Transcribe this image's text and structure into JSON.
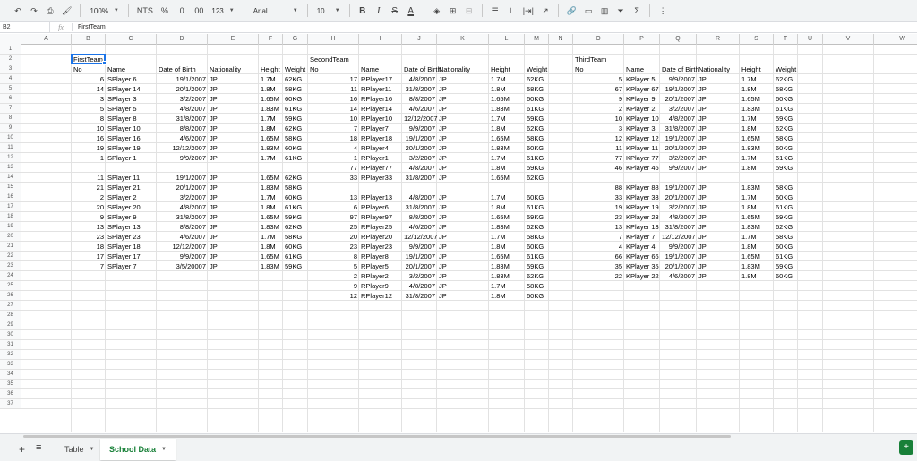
{
  "toolbar": {
    "zoom": "100%",
    "currency": "NTS",
    "percent": "%",
    "dec_decrease": ".0",
    "dec_increase": ".00",
    "number_format": "123",
    "font": "Arial",
    "font_size": "10",
    "bold": "B",
    "italic": "I",
    "strike": "S",
    "text_color": "A"
  },
  "formula_bar": {
    "cell_ref": "B2",
    "value": "FirstTeam"
  },
  "columns": [
    "A",
    "B",
    "C",
    "D",
    "E",
    "F",
    "G",
    "H",
    "I",
    "J",
    "K",
    "L",
    "M",
    "N",
    "O",
    "P",
    "Q",
    "R",
    "S",
    "T",
    "U",
    "V",
    "W"
  ],
  "rows": [
    "1",
    "2",
    "3",
    "4",
    "5",
    "6",
    "7",
    "8",
    "9",
    "10",
    "11",
    "12",
    "13",
    "14",
    "15",
    "16",
    "17",
    "18",
    "19",
    "20",
    "21",
    "22",
    "23",
    "24",
    "25",
    "26",
    "27",
    "28",
    "29",
    "30",
    "31",
    "32",
    "33",
    "34",
    "35",
    "36",
    "37"
  ],
  "teams": {
    "first": {
      "title": "FirstTeam",
      "headers": [
        "No",
        "Name",
        "Date of Birth",
        "Nationality",
        "Height",
        "Weight"
      ],
      "rows": [
        [
          "6",
          "SPlayer 6",
          "19/1/2007",
          "JP",
          "1.7M",
          "62KG"
        ],
        [
          "14",
          "SPlayer 14",
          "20/1/2007",
          "JP",
          "1.8M",
          "58KG"
        ],
        [
          "3",
          "SPlayer 3",
          "3/2/2007",
          "JP",
          "1.65M",
          "60KG"
        ],
        [
          "5",
          "SPlayer 5",
          "4/8/2007",
          "JP",
          "1.83M",
          "61KG"
        ],
        [
          "8",
          "SPlayer 8",
          "31/8/2007",
          "JP",
          "1.7M",
          "59KG"
        ],
        [
          "10",
          "SPlayer 10",
          "8/8/2007",
          "JP",
          "1.8M",
          "62KG"
        ],
        [
          "16",
          "SPlayer 16",
          "4/6/2007",
          "JP",
          "1.65M",
          "58KG"
        ],
        [
          "19",
          "SPlayer 19",
          "12/12/2007",
          "JP",
          "1.83M",
          "60KG"
        ],
        [
          "1",
          "SPlayer 1",
          "9/9/2007",
          "JP",
          "1.7M",
          "61KG"
        ],
        [
          "",
          "",
          "",
          "",
          "",
          ""
        ],
        [
          "11",
          "SPlayer 11",
          "19/1/2007",
          "JP",
          "1.65M",
          "62KG"
        ],
        [
          "21",
          "SPlayer 21",
          "20/1/2007",
          "JP",
          "1.83M",
          "58KG"
        ],
        [
          "2",
          "SPlayer 2",
          "3/2/2007",
          "JP",
          "1.7M",
          "60KG"
        ],
        [
          "20",
          "SPlayer 20",
          "4/8/2007",
          "JP",
          "1.8M",
          "61KG"
        ],
        [
          "9",
          "SPlayer 9",
          "31/8/2007",
          "JP",
          "1.65M",
          "59KG"
        ],
        [
          "13",
          "SPlayer 13",
          "8/8/2007",
          "JP",
          "1.83M",
          "62KG"
        ],
        [
          "23",
          "SPlayer 23",
          "4/6/2007",
          "JP",
          "1.7M",
          "58KG"
        ],
        [
          "18",
          "SPlayer 18",
          "12/12/2007",
          "JP",
          "1.8M",
          "60KG"
        ],
        [
          "17",
          "SPlayer 17",
          "9/9/2007",
          "JP",
          "1.65M",
          "61KG"
        ],
        [
          "7",
          "SPlayer 7",
          "3/5/20007",
          "JP",
          "1.83M",
          "59KG"
        ]
      ]
    },
    "second": {
      "title": "SecondTeam",
      "headers": [
        "No",
        "Name",
        "Date of Birth",
        "Nationality",
        "Height",
        "Weight"
      ],
      "rows": [
        [
          "17",
          "RPlayer17",
          "4/8/2007",
          "JP",
          "1.7M",
          "62KG"
        ],
        [
          "11",
          "RPlayer11",
          "31/8/2007",
          "JP",
          "1.8M",
          "58KG"
        ],
        [
          "16",
          "RPlayer16",
          "8/8/2007",
          "JP",
          "1.65M",
          "60KG"
        ],
        [
          "14",
          "RPlayer14",
          "4/6/2007",
          "JP",
          "1.83M",
          "61KG"
        ],
        [
          "10",
          "RPlayer10",
          "12/12/2007",
          "JP",
          "1.7M",
          "59KG"
        ],
        [
          "7",
          "RPlayer7",
          "9/9/2007",
          "JP",
          "1.8M",
          "62KG"
        ],
        [
          "18",
          "RPlayer18",
          "19/1/2007",
          "JP",
          "1.65M",
          "58KG"
        ],
        [
          "4",
          "RPlayer4",
          "20/1/2007",
          "JP",
          "1.83M",
          "60KG"
        ],
        [
          "1",
          "RPlayer1",
          "3/2/2007",
          "JP",
          "1.7M",
          "61KG"
        ],
        [
          "77",
          "RPlayer77",
          "4/8/2007",
          "JP",
          "1.8M",
          "59KG"
        ],
        [
          "33",
          "RPlayer33",
          "31/8/2007",
          "JP",
          "1.65M",
          "62KG"
        ],
        [
          "",
          "",
          "",
          "",
          "",
          ""
        ],
        [
          "13",
          "RPlayer13",
          "4/8/2007",
          "JP",
          "1.7M",
          "60KG"
        ],
        [
          "6",
          "RPlayer6",
          "31/8/2007",
          "JP",
          "1.8M",
          "61KG"
        ],
        [
          "97",
          "RPlayer97",
          "8/8/2007",
          "JP",
          "1.65M",
          "59KG"
        ],
        [
          "25",
          "RPlayer25",
          "4/6/2007",
          "JP",
          "1.83M",
          "62KG"
        ],
        [
          "20",
          "RPlayer20",
          "12/12/2007",
          "JP",
          "1.7M",
          "58KG"
        ],
        [
          "23",
          "RPlayer23",
          "9/9/2007",
          "JP",
          "1.8M",
          "60KG"
        ],
        [
          "8",
          "RPlayer8",
          "19/1/2007",
          "JP",
          "1.65M",
          "61KG"
        ],
        [
          "5",
          "RPlayer5",
          "20/1/2007",
          "JP",
          "1.83M",
          "59KG"
        ],
        [
          "2",
          "RPlayer2",
          "3/2/2007",
          "JP",
          "1.83M",
          "62KG"
        ],
        [
          "9",
          "RPlayer9",
          "4/8/2007",
          "JP",
          "1.7M",
          "58KG"
        ],
        [
          "12",
          "RPlayer12",
          "31/8/2007",
          "JP",
          "1.8M",
          "60KG"
        ]
      ]
    },
    "third": {
      "title": "ThirdTeam",
      "headers": [
        "No",
        "Name",
        "Date of Birth",
        "Nationality",
        "Height",
        "Weight"
      ],
      "rows": [
        [
          "5",
          "KPlayer 5",
          "9/9/2007",
          "JP",
          "1.7M",
          "62KG"
        ],
        [
          "67",
          "KPlayer 67",
          "19/1/2007",
          "JP",
          "1.8M",
          "58KG"
        ],
        [
          "9",
          "KPlayer 9",
          "20/1/2007",
          "JP",
          "1.65M",
          "60KG"
        ],
        [
          "2",
          "KPlayer 2",
          "3/2/2007",
          "JP",
          "1.83M",
          "61KG"
        ],
        [
          "10",
          "KPlayer 10",
          "4/8/2007",
          "JP",
          "1.7M",
          "59KG"
        ],
        [
          "3",
          "KPlayer 3",
          "31/8/2007",
          "JP",
          "1.8M",
          "62KG"
        ],
        [
          "12",
          "KPlayer 12",
          "19/1/2007",
          "JP",
          "1.65M",
          "58KG"
        ],
        [
          "11",
          "KPlayer 11",
          "20/1/2007",
          "JP",
          "1.83M",
          "60KG"
        ],
        [
          "77",
          "KPlayer 77",
          "3/2/2007",
          "JP",
          "1.7M",
          "61KG"
        ],
        [
          "46",
          "KPlayer 46",
          "9/9/2007",
          "JP",
          "1.8M",
          "59KG"
        ],
        [
          "",
          "",
          "",
          "",
          "",
          ""
        ],
        [
          "88",
          "KPlayer 88",
          "19/1/2007",
          "JP",
          "1.83M",
          "58KG"
        ],
        [
          "33",
          "KPlayer 33",
          "20/1/2007",
          "JP",
          "1.7M",
          "60KG"
        ],
        [
          "19",
          "KPlayer 19",
          "3/2/2007",
          "JP",
          "1.8M",
          "61KG"
        ],
        [
          "23",
          "KPlayer 23",
          "4/8/2007",
          "JP",
          "1.65M",
          "59KG"
        ],
        [
          "13",
          "KPlayer 13",
          "31/8/2007",
          "JP",
          "1.83M",
          "62KG"
        ],
        [
          "7",
          "KPlayer 7",
          "12/12/2007",
          "JP",
          "1.7M",
          "58KG"
        ],
        [
          "4",
          "KPlayer 4",
          "9/9/2007",
          "JP",
          "1.8M",
          "60KG"
        ],
        [
          "66",
          "KPlayer 66",
          "19/1/2007",
          "JP",
          "1.65M",
          "61KG"
        ],
        [
          "35",
          "KPlayer 35",
          "20/1/2007",
          "JP",
          "1.83M",
          "59KG"
        ],
        [
          "22",
          "KPlayer 22",
          "4/6/2007",
          "JP",
          "1.8M",
          "60KG"
        ]
      ]
    }
  },
  "sheet_tabs": [
    {
      "label": "Table",
      "active": false
    },
    {
      "label": "School Data",
      "active": true
    }
  ],
  "colors": {
    "accent": "#1a73e8",
    "active_tab": "#188038"
  }
}
